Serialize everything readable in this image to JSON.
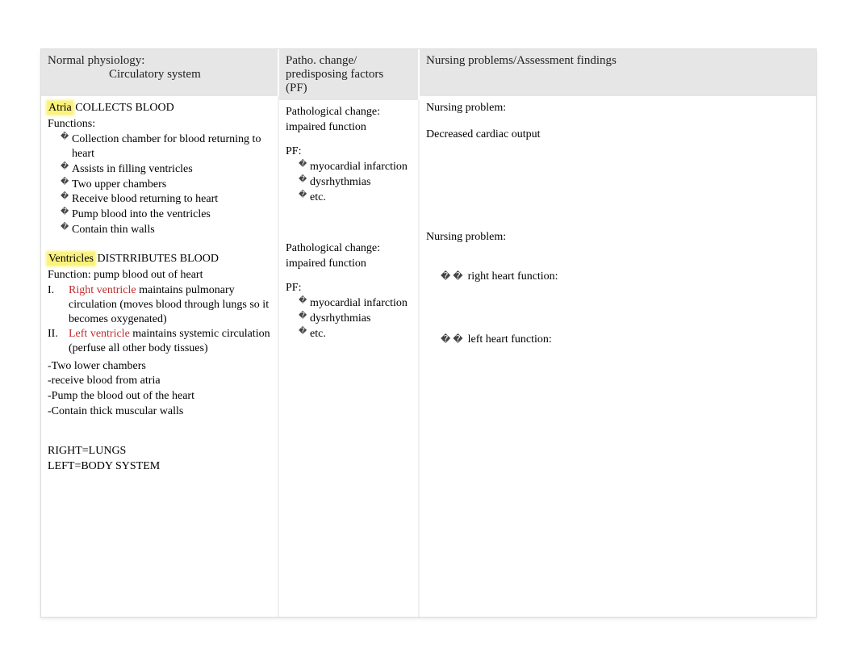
{
  "headers": {
    "col1_line1": "Normal physiology:",
    "col1_line2": "Circulatory system",
    "col2_line1": "Patho. change/",
    "col2_line2": "predisposing factors",
    "col2_line3": "(PF)",
    "col3": "Nursing problems/Assessment findings"
  },
  "col1": {
    "atria_hl": "Atria",
    "atria_rest": "  COLLECTS BLOOD",
    "functions_label": "Functions:",
    "atria_bullets": [
      "Collection chamber for blood returning to heart",
      "Assists in filling ventricles",
      "Two upper chambers",
      "Receive blood returning to heart",
      "Pump blood into the ventricles",
      "Contain thin walls"
    ],
    "ventricles_hl": "Ventricles",
    "ventricles_rest": "  DISTRRIBUTES BLOOD",
    "function_label": "Function:   pump blood out of heart",
    "roman": [
      {
        "num": "I.",
        "red": "Right ventricle",
        "rest": " maintains pulmonary circulation (moves blood through lungs so it becomes oxygenated)"
      },
      {
        "num": "II.",
        "red": "Left ventricle",
        "rest": " maintains systemic circulation (perfuse all other body tissues)"
      }
    ],
    "extras": [
      "-Two lower chambers",
      "-receive blood from atria",
      "-Pump the blood out of the heart",
      "-Contain thick muscular walls"
    ],
    "bottom1": "RIGHT=LUNGS",
    "bottom2": "LEFT=BODY SYSTEM"
  },
  "col2": {
    "block1": {
      "l1": "Pathological change:",
      "l2": "impaired function",
      "pf": "PF:",
      "bullets": [
        "myocardial infarction",
        "dysrhythmias",
        "etc."
      ]
    },
    "block2": {
      "l1": "Pathological change:",
      "l2": "impaired function",
      "pf": "PF:",
      "bullets": [
        "myocardial infarction",
        "dysrhythmias",
        "etc."
      ]
    }
  },
  "col3": {
    "np1_label": "Nursing problem:",
    "np1_text": "Decreased cardiac output",
    "np2_label": "Nursing problem:",
    "arrow_glyph": "� �",
    "right_heart": "right heart function:",
    "left_heart": "left heart function:"
  }
}
